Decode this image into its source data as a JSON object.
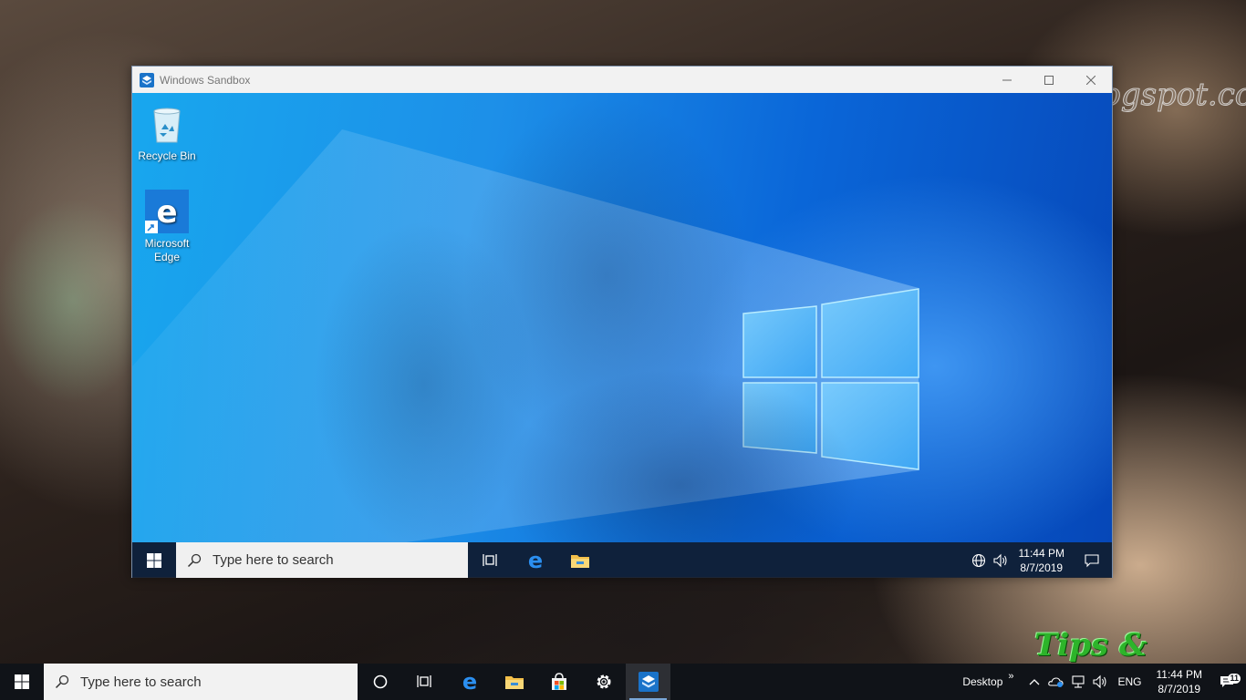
{
  "host": {
    "watermark_url": "tipsorialindo.blogspot.com",
    "watermark_brand": "Tips & Tutorial",
    "taskbar": {
      "search_placeholder": "Type here to search",
      "desktop_label": "Desktop",
      "desktop_chevron": "»",
      "language": "ENG",
      "time": "11:44 PM",
      "date": "8/7/2019",
      "notification_count": "11",
      "apps": [
        "cortana-icon",
        "task-view-icon",
        "edge-icon",
        "file-explorer-icon",
        "store-icon",
        "settings-icon",
        "windows-sandbox-icon"
      ]
    }
  },
  "sandbox": {
    "window_title": "Windows Sandbox",
    "desktop_icons": [
      {
        "label": "Recycle Bin",
        "icon": "recycle-bin-icon"
      },
      {
        "label": "Microsoft Edge",
        "icon": "edge-icon"
      }
    ],
    "taskbar": {
      "search_placeholder": "Type here to search",
      "time": "11:44 PM",
      "date": "8/7/2019",
      "apps": [
        "task-view-icon",
        "edge-icon",
        "file-explorer-icon"
      ]
    }
  },
  "colors": {
    "accent": "#0078d7",
    "sandbox_wallpaper": "#0b63d6",
    "brand_green": "#2db42a"
  }
}
